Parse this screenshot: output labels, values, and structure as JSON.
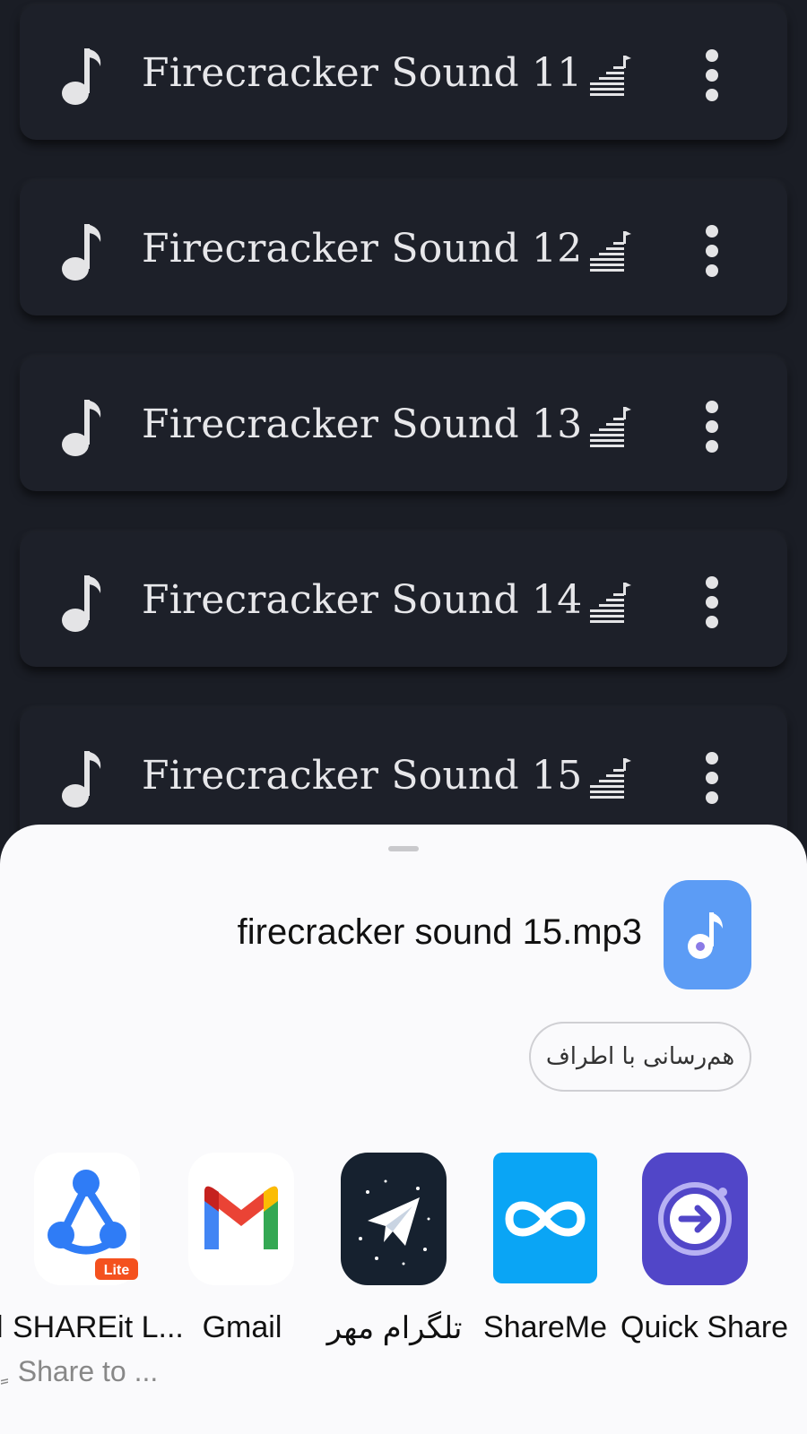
{
  "list": {
    "items": [
      {
        "title": "Firecracker Sound 11"
      },
      {
        "title": "Firecracker Sound 12"
      },
      {
        "title": "Firecracker Sound 13"
      },
      {
        "title": "Firecracker Sound 14"
      },
      {
        "title": "Firecracker Sound 15"
      }
    ]
  },
  "share_sheet": {
    "file_name": "firecracker sound 15.mp3",
    "nearby_label": "هم‌رسانی با اطراف",
    "apps": [
      {
        "label": "SHAREit L...",
        "sublabel": "Share to ...",
        "icon": "shareit-lite-icon"
      },
      {
        "label": "Gmail",
        "sublabel": "",
        "icon": "gmail-icon"
      },
      {
        "label": "تلگرام مهر",
        "sublabel": "",
        "icon": "telegram-mehr-icon"
      },
      {
        "label": "ShareMe",
        "sublabel": "",
        "icon": "shareme-icon"
      },
      {
        "label": "Quick Share",
        "sublabel": "",
        "icon": "quick-share-icon"
      }
    ]
  },
  "colors": {
    "background": "#1a1d25",
    "card": "#1d2029",
    "sheet": "#fafafc",
    "file_icon": "#5c9cf5"
  }
}
